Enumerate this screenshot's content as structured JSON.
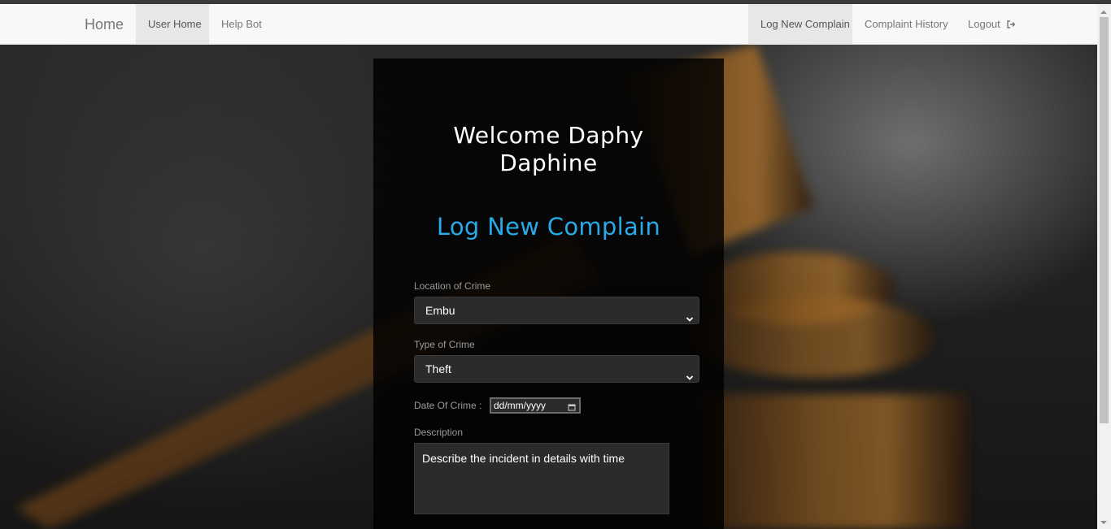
{
  "navbar": {
    "brand": "Home",
    "left_links": [
      {
        "label": "User Home",
        "active": true
      },
      {
        "label": "Help Bot",
        "active": false
      }
    ],
    "right_links": [
      {
        "label": "Log New Complain",
        "active": true
      },
      {
        "label": "Complaint History",
        "active": false
      },
      {
        "label": "Logout",
        "active": false,
        "icon": "logout-icon"
      }
    ]
  },
  "welcome": {
    "line1": "Welcome Daphy",
    "line2": "Daphine"
  },
  "form": {
    "title": "Log New Complain",
    "location_label": "Location of Crime",
    "location_value": "Embu",
    "crime_type_label": "Type of Crime",
    "crime_type_value": "Theft",
    "date_label": "Date Of Crime :",
    "date_placeholder": "dd/mm/yyyy",
    "description_label": "Description",
    "description_placeholder": "Describe the incident in details with time"
  },
  "colors": {
    "accent": "#29a9e8",
    "navbar_bg": "#f8f8f8",
    "panel_bg": "#000000"
  }
}
